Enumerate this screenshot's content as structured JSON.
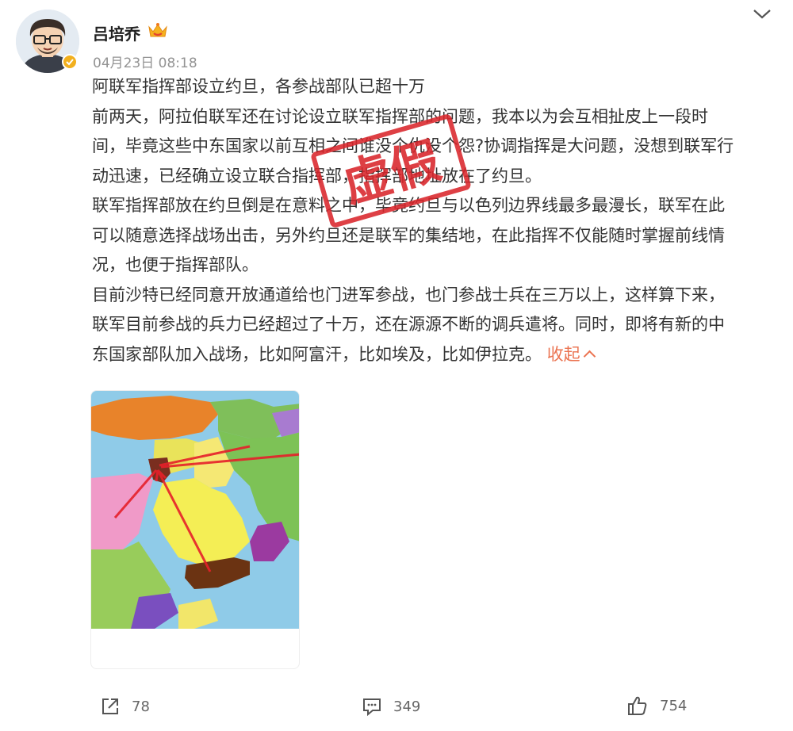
{
  "post": {
    "author": "吕培乔",
    "time": "04月23日 08:18",
    "lines": [
      "阿联军指挥部设立约旦，各参战部队已超十万",
      "前两天，阿拉伯联军还在讨论设立联军指挥部的问题，我本以为会互相扯皮上一段时",
      "间，毕竟这些中东国家以前互相之间谁没个仇没个怨?协调指挥是大问题，没想到联军行",
      "动迅速，已经确立设立联合指挥部，指挥部地址放在了约旦。",
      "联军指挥部放在约旦倒是在意料之中，毕竟约旦与以色列边界线最多最漫长，联军在此",
      "可以随意选择战场出击，另外约旦还是联军的集结地，在此指挥不仅能随时掌握前线情",
      "况，也便于指挥部队。",
      "目前沙特已经同意开放通道给也门进军参战，也门参战士兵在三万以上，这样算下来，",
      "联军目前参战的兵力已经超过了十万，还在源源不断的调兵遣将。同时，即将有新的中",
      "东国家部队加入战场，比如阿富汗，比如埃及，比如伊拉克。"
    ],
    "collapse_label": "收起",
    "stamp_text": "虚假"
  },
  "actions": {
    "share_count": "78",
    "comment_count": "349",
    "like_count": "754"
  },
  "colors": {
    "link": "#eb7350",
    "stamp": "#d9252b",
    "badge": "#f2b01e"
  },
  "icons": [
    "crown-icon",
    "chevron-down-icon",
    "verified-icon",
    "share-icon",
    "comment-icon",
    "like-icon"
  ]
}
